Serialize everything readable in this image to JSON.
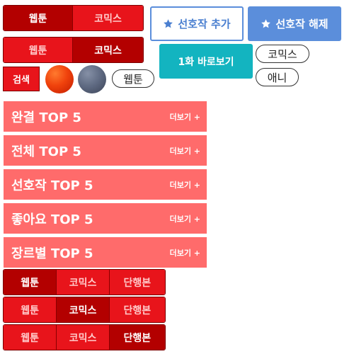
{
  "toggle_row1": {
    "webtoon": "웹툰",
    "comics": "코믹스",
    "active": "webtoon"
  },
  "toggle_row2": {
    "webtoon": "웹툰",
    "comics": "코믹스",
    "active": "comics"
  },
  "search_label": "검색",
  "pills": {
    "webtoon": "웹툰",
    "comics": "코믹스",
    "anime": "애니"
  },
  "favorite": {
    "add_label": "선호작 추가",
    "remove_label": "선호작 해제",
    "icon": "star-icon"
  },
  "first_episode_label": "1화 바로보기",
  "rankings": [
    {
      "title": "완결 TOP 5",
      "more": "더보기 +"
    },
    {
      "title": "전체 TOP 5",
      "more": "더보기 +"
    },
    {
      "title": "선호작 TOP 5",
      "more": "더보기 +"
    },
    {
      "title": "좋아요 TOP 5",
      "more": "더보기 +"
    },
    {
      "title": "장르별 TOP 5",
      "more": "더보기 +"
    }
  ],
  "format_toggles": [
    {
      "webtoon": "웹툰",
      "comics": "코믹스",
      "volume": "단행본",
      "active": "webtoon"
    },
    {
      "webtoon": "웹툰",
      "comics": "코믹스",
      "volume": "단행본",
      "active": "comics"
    },
    {
      "webtoon": "웹툰",
      "comics": "코믹스",
      "volume": "단행본",
      "active": "volume"
    }
  ],
  "colors": {
    "toggle_active": "#b30000",
    "toggle_inactive": "#e8141b",
    "ranking_bg": "#ff6b6b",
    "favorite_blue": "#5b8edb",
    "first_episode_teal": "#13b4c0"
  }
}
